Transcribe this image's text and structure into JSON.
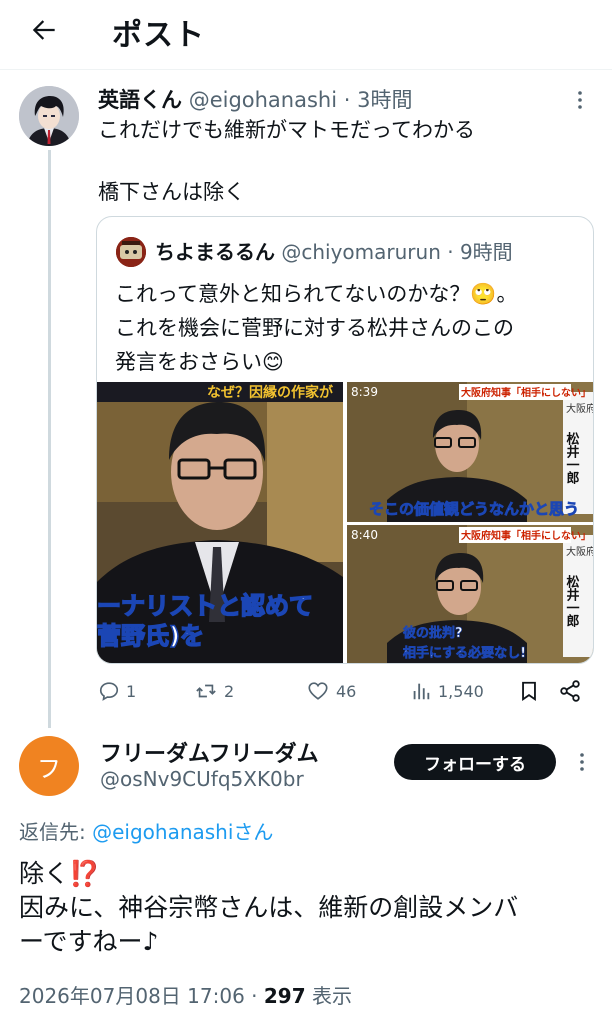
{
  "header": {
    "title": "ポスト",
    "back_icon": "arrow-left-icon"
  },
  "post1": {
    "author_name": "英語くん",
    "handle": "@eigohanashi",
    "sep": "·",
    "time": "3時間",
    "text_line1": "これだけでも維新がマトモだってわかる",
    "text_line2": "橋下さんは除く",
    "quote": {
      "author_name": "ちよまるるん",
      "handle": "@chiyomarurun",
      "sep": "·",
      "time": "9時間",
      "text_line1": "これって意外と知られてないのかな？🙄。",
      "text_line2": "これを機会に菅野に対する松井さんのこの",
      "text_line3": "発言をおさらい😊",
      "images": {
        "a_caption_top": "なぜ？因縁の作家が",
        "a_caption_mid": "ーナリストと認めて",
        "a_caption_bottom": "菅野氏)を",
        "b_time": "8:39",
        "b_banner": "大阪府知事「相手にしない」",
        "b_caption": "そこの価値観どうなんかと思う",
        "b_side_title": "大阪府知事",
        "b_side_name": "松井一郎",
        "c_time": "8:40",
        "c_banner": "大阪府知事「相手にしない」",
        "c_caption_1": "彼の批判?",
        "c_caption_2": "相手にする必要なし!",
        "c_side_title": "大阪府知事",
        "c_side_name": "松井一郎"
      }
    },
    "actions": {
      "replies": "1",
      "retweets": "2",
      "likes": "46",
      "views": "1,540"
    }
  },
  "post2": {
    "avatar_letter": "フ",
    "author_name": "フリーダムフリーダム",
    "handle": "@osNv9CUfq5XK0br",
    "follow_label": "フォローする",
    "reply_prefix": "返信先: ",
    "reply_handle": "@eigohanashiさん",
    "text_line1": "除く⁉️",
    "text_line2": "因みに、神谷宗幣さんは、維新の創設メンバ",
    "text_line3": "ーですねー♪",
    "date": "2026年07月08日 17:06",
    "sep": " · ",
    "views_count": "297",
    "views_label": " 表示"
  },
  "colors": {
    "accent": "#1d9bf0",
    "text": "#0f1419",
    "muted": "#536471",
    "avatar2_bg": "#f08321"
  }
}
